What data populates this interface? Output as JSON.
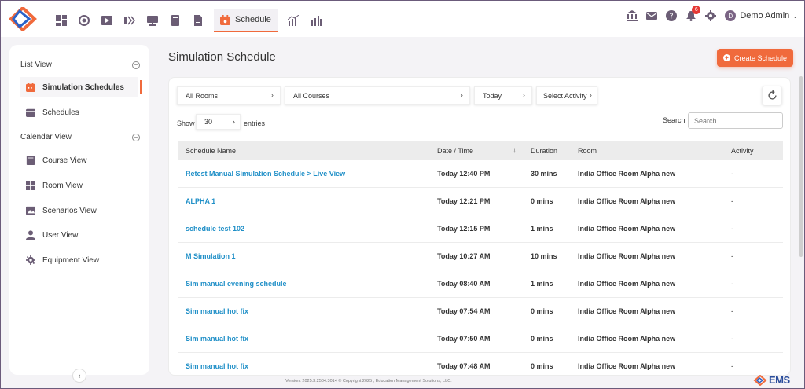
{
  "nav": {
    "active_tab": "Schedule",
    "user_initial": "D",
    "user_name": "Demo Admin",
    "notification_count": "6"
  },
  "sidebar": {
    "list_view_header": "List View",
    "list_items": [
      {
        "label": "Simulation Schedules",
        "icon": "calendar-icon"
      },
      {
        "label": "Schedules",
        "icon": "calendar-icon"
      }
    ],
    "calendar_view_header": "Calendar View",
    "calendar_items": [
      {
        "label": "Course View",
        "icon": "book-icon"
      },
      {
        "label": "Room View",
        "icon": "grid-icon"
      },
      {
        "label": "Scenarios View",
        "icon": "image-icon"
      },
      {
        "label": "User View",
        "icon": "user-icon"
      },
      {
        "label": "Equipment View",
        "icon": "gear-icon"
      }
    ]
  },
  "main": {
    "title": "Simulation Schedule",
    "create_label": "Create Schedule",
    "filters": {
      "rooms": "All Rooms",
      "courses": "All Courses",
      "date": "Today",
      "activity": "Select Activity"
    },
    "show_label": "Show",
    "entries_value": "30",
    "entries_label": "entries",
    "search_label": "Search",
    "search_placeholder": "Search"
  },
  "table": {
    "headers": [
      "Schedule Name",
      "Date / Time",
      "Duration",
      "Room",
      "Activity"
    ],
    "rows": [
      [
        "Retest Manual Simulation Schedule > Live View",
        "Today 12:40 PM",
        "30 mins",
        "India Office Room Alpha new",
        "-"
      ],
      [
        "ALPHA 1",
        "Today 12:21 PM",
        "0 mins",
        "India Office Room Alpha new",
        "-"
      ],
      [
        "schedule test 102",
        "Today 12:15 PM",
        "1 mins",
        "India Office Room Alpha new",
        "-"
      ],
      [
        "M Simulation 1",
        "Today 10:27 AM",
        "10 mins",
        "India Office Room Alpha new",
        "-"
      ],
      [
        "Sim manual evening schedule",
        "Today 08:40 AM",
        "1 mins",
        "India Office Room Alpha new",
        "-"
      ],
      [
        "Sim manual hot fix",
        "Today 07:54 AM",
        "0 mins",
        "India Office Room Alpha new",
        "-"
      ],
      [
        "Sim manual hot fix",
        "Today 07:50 AM",
        "0 mins",
        "India Office Room Alpha new",
        "-"
      ],
      [
        "Sim manual hot fix",
        "Today 07:48 AM",
        "0 mins",
        "India Office Room Alpha new",
        "-"
      ]
    ]
  },
  "footer": {
    "text": "Version: 2025.3.2504.3014 © Copyright 2025 , Education Management Solutions, LLC.",
    "brand": "EMS"
  },
  "colors": {
    "accent": "#f06a3c",
    "link": "#1f8fc7",
    "icon": "#6b5d75"
  }
}
